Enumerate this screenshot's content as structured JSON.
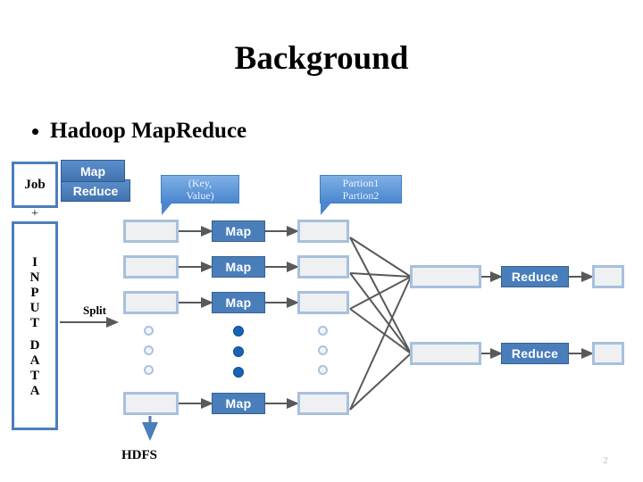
{
  "slide": {
    "title": "Background",
    "bullet": "Hadoop MapReduce",
    "page_number": "2"
  },
  "diagram": {
    "job_box_label": "Job",
    "plus_label": "+",
    "input_data_letters": [
      "I",
      "N",
      "P",
      "U",
      "T",
      "",
      "D",
      "A",
      "T",
      "A"
    ],
    "input_data_text": "INPUT DATA",
    "chips": [
      {
        "label": "Map"
      },
      {
        "label": "Reduce"
      }
    ],
    "callouts": [
      {
        "name": "key-value",
        "line1": "(Key,",
        "line2": "Value)"
      },
      {
        "name": "partitions",
        "line1": "Partion1",
        "line2": "Partion2"
      }
    ],
    "split_label": "Split",
    "hdfs_label": "HDFS",
    "map_rows": [
      {
        "input": "",
        "process": "Map",
        "output": ""
      },
      {
        "input": "",
        "process": "Map",
        "output": ""
      },
      {
        "input": "",
        "process": "Map",
        "output": ""
      },
      {
        "input": "",
        "process": "Map",
        "output": ""
      }
    ],
    "reduce_rows": [
      {
        "input": "",
        "process": "Reduce",
        "output": ""
      },
      {
        "input": "",
        "process": "Reduce",
        "output": ""
      }
    ],
    "ellipsis_columns": [
      {
        "name": "split-ellipsis",
        "style": "open",
        "count": 3
      },
      {
        "name": "map-ellipsis",
        "style": "solid",
        "count": 3
      },
      {
        "name": "partition-ellipsis",
        "style": "open",
        "count": 3
      }
    ],
    "colors": {
      "process_blue": "#4a7ebb",
      "box_border_blue": "#a7c0dd",
      "box_fill_grey": "#eef0f2",
      "outline_blue": "#4d7ebb",
      "callout_blue": "#4a86cf",
      "arrow_grey": "#595959",
      "hdfs_arrow_blue": "#4a7ebb",
      "page_number_grey": "#b9b9b9"
    }
  }
}
